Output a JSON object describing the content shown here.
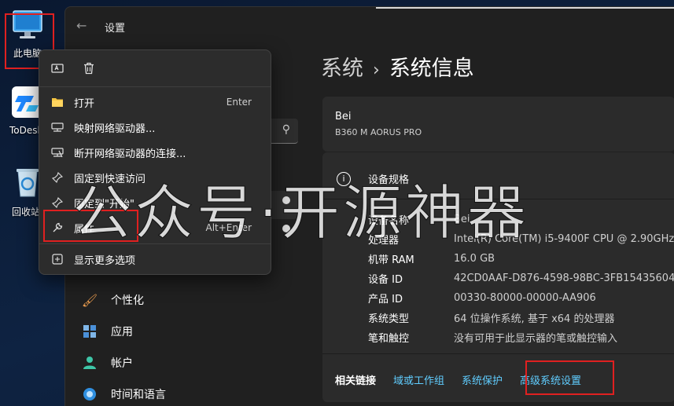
{
  "desktop": {
    "icons": [
      {
        "label": "此电脑",
        "icon": "computer-icon"
      },
      {
        "label": "ToDesk",
        "icon": "todesk-icon"
      },
      {
        "label": "回收站",
        "icon": "recycle-bin-icon"
      }
    ]
  },
  "settings": {
    "app_title": "设置",
    "breadcrumb": {
      "parent": "系统",
      "separator": "›",
      "current": "系统信息"
    },
    "device": {
      "name": "Bei",
      "model": "B360 M AORUS PRO"
    },
    "specs": {
      "heading": "设备规格",
      "rows": [
        {
          "key": "设备名称",
          "value": "Bei"
        },
        {
          "key": "处理器",
          "value": "Intel(R) Core(TM) i5-9400F CPU @ 2.90GHz"
        },
        {
          "key": "机带 RAM",
          "value": "16.0 GB"
        },
        {
          "key": "设备 ID",
          "value": "42CD0AAF-D876-4598-98BC-3FB154356047"
        },
        {
          "key": "产品 ID",
          "value": "00330-80000-00000-AA906"
        },
        {
          "key": "系统类型",
          "value": "64 位操作系统, 基于 x64 的处理器"
        },
        {
          "key": "笔和触控",
          "value": "没有可用于此显示器的笔或触控输入"
        }
      ]
    },
    "related_links": {
      "label": "相关链接",
      "links": [
        "域或工作组",
        "系统保护",
        "高级系统设置"
      ]
    },
    "nav": [
      {
        "label": "个性化",
        "icon": "brush-icon"
      },
      {
        "label": "应用",
        "icon": "apps-icon"
      },
      {
        "label": "帐户",
        "icon": "account-icon"
      },
      {
        "label": "时间和语言",
        "icon": "globe-clock-icon"
      }
    ]
  },
  "context_menu": {
    "top_icons": [
      "rename-icon",
      "delete-icon"
    ],
    "items": [
      {
        "label": "打开",
        "shortcut": "Enter",
        "icon": "folder-icon"
      },
      {
        "label": "映射网络驱动器...",
        "shortcut": "",
        "icon": "map-drive-icon"
      },
      {
        "label": "断开网络驱动器的连接...",
        "shortcut": "",
        "icon": "disconnect-drive-icon"
      },
      {
        "label": "固定到快速访问",
        "shortcut": "",
        "icon": "pin-icon"
      },
      {
        "label": "固定到\"开始\"",
        "shortcut": "",
        "icon": "pin-icon"
      },
      {
        "label": "属性",
        "shortcut": "Alt+Enter",
        "icon": "wrench-icon"
      },
      {
        "label": "显示更多选项",
        "shortcut": "",
        "icon": "more-options-icon"
      }
    ]
  },
  "watermark": "公众号·开源神器",
  "colors": {
    "link": "#60cdff",
    "highlight_box": "#e02020",
    "window_bg": "#202020",
    "card_bg": "#2b2b2b"
  }
}
